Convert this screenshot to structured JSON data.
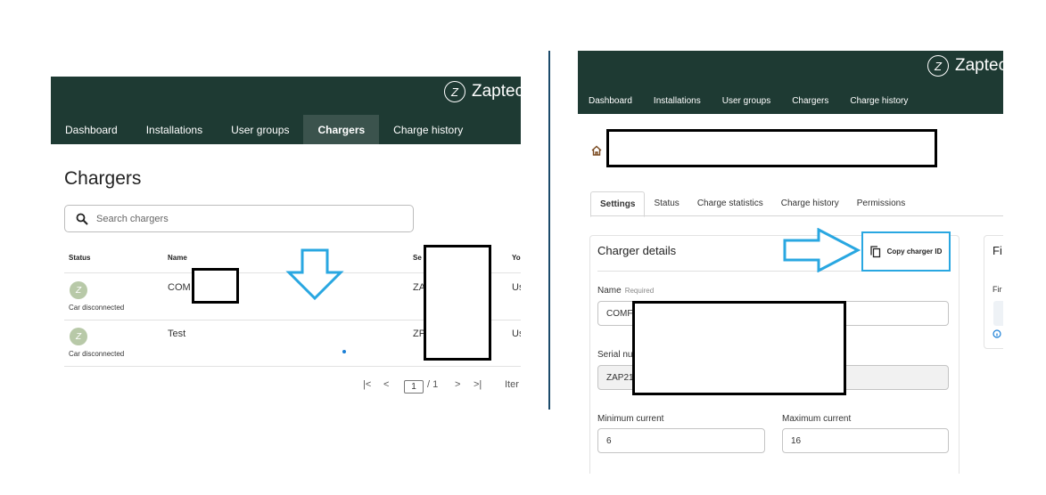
{
  "brand": {
    "name": "Zaptec",
    "mark": "Z"
  },
  "colors": {
    "topbar": "#1e3a33",
    "nav_active": "#3b534d",
    "annotation": "#29a7e1",
    "avatar": "#b8c9a8"
  },
  "left": {
    "nav": [
      "Dashboard",
      "Installations",
      "User groups",
      "Chargers",
      "Charge history"
    ],
    "active_nav": "Chargers",
    "page_title": "Chargers",
    "search": {
      "placeholder": "Search chargers"
    },
    "columns": [
      "Status",
      "Name",
      "Se",
      "Yo"
    ],
    "rows": [
      {
        "status": "Car disconnected",
        "name": "COM",
        "serial": "ZA",
        "extra": "Us"
      },
      {
        "status": "Car disconnected",
        "name": "Test",
        "serial": "ZP",
        "extra": "Us"
      }
    ],
    "pager": {
      "first": "|<",
      "prev": "<",
      "page": "1",
      "of": "/ 1",
      "next": ">",
      "last": ">|",
      "items": "Iter"
    }
  },
  "right": {
    "nav": [
      "Dashboard",
      "Installations",
      "User groups",
      "Chargers",
      "Charge history"
    ],
    "tabs": [
      "Settings",
      "Status",
      "Charge statistics",
      "Charge history",
      "Permissions"
    ],
    "active_tab": "Settings",
    "card_title": "Charger details",
    "copy_button": "Copy charger ID",
    "side_card_title": "Fi",
    "side_card_label": "Fir",
    "fields": {
      "name_label": "Name",
      "name_required": "Required",
      "name_value": "COMF",
      "serial_label": "Serial nu",
      "serial_value": "ZAP21",
      "min_label": "Minimum current",
      "min_value": "6",
      "max_label": "Maximum current",
      "max_value": "16"
    }
  },
  "icons": [
    "search-icon",
    "home-icon",
    "copy-icon",
    "info-icon",
    "brand-logo-icon"
  ]
}
